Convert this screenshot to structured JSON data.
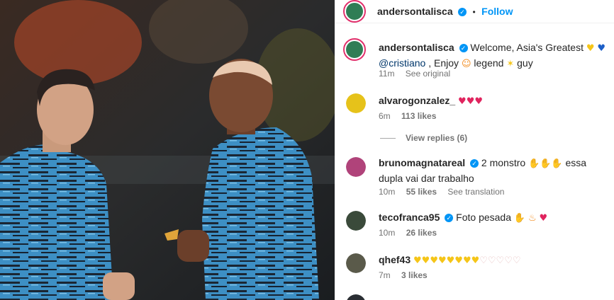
{
  "post": {
    "author": "andersontalisca",
    "follow_label": "Follow",
    "dot": "•"
  },
  "caption": {
    "user": "andersontalisca",
    "text_1": "Welcome, Asia's Greatest",
    "mention": "@cristiano",
    "text_2": ", Enjoy",
    "text_3": "legend",
    "text_4": "guy",
    "time": "11m",
    "see_original": "See original"
  },
  "comments": [
    {
      "user": "alvarogonzalez_",
      "verified": false,
      "text": "",
      "emojis": "😍😍😍",
      "time": "6m",
      "likes": "113 likes",
      "action": ""
    },
    {
      "user": "brunomagnatareal",
      "verified": true,
      "text": "2 monstro",
      "text_after": "essa dupla vai dar trabalho",
      "emojis": "👏👏👏",
      "time": "10m",
      "likes": "55 likes",
      "action": "See translation"
    },
    {
      "user": "tecofranca95",
      "verified": true,
      "text": "Foto pesada",
      "emojis": "👏🔥😍",
      "time": "10m",
      "likes": "26 likes",
      "action": ""
    },
    {
      "user": "qhef43",
      "verified": false,
      "text": "",
      "emojis": "💛💛💛💛💛💛💛💛🤍🤍🤍🤍🤍",
      "time": "7m",
      "likes": "3 likes",
      "action": ""
    }
  ],
  "view_replies": "View replies (6)",
  "colors": {
    "accent": "#0095f6",
    "verified": "#0095f6",
    "jersey": "#3a86b8"
  }
}
